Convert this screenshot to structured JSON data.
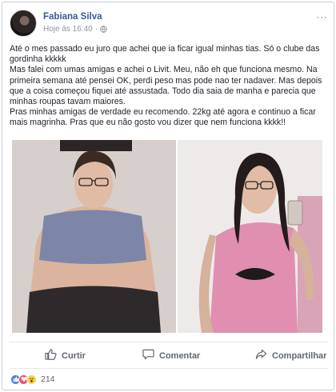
{
  "post": {
    "author": "Fabiana Silva",
    "timestamp": "Hoje às 16:40",
    "more_glyph": "···",
    "paragraphs": [
      "Até o mes passado eu juro que achei que ia ficar igual minhas tias. Só o clube das gordinha kkkkk",
      "Mas falei com umas amigas e achei o Livit. Meu, não eh que funciona mesmo. Na primeira semana até pensei OK, perdi peso mas pode nao ter nadaver. Mas depois que a coisa começou fiquei até assustada. Todo dia saia de manha e parecia que minhas roupas tavam maiores.",
      "Pras minhas amigas de verdade eu recomendo. 22kg até agora e continuo a ficar mais magrinha. Pras que eu não gosto vou dizer que nem funciona kkkk!!"
    ]
  },
  "actions": {
    "like": "Curtir",
    "comment": "Comentar",
    "share": "Compartilhar"
  },
  "reactions": {
    "count": "214",
    "types": [
      "like-icon",
      "love-icon",
      "wow-icon"
    ],
    "colors": {
      "like": "#4f7fe0",
      "love": "#f0506e",
      "wow": "#f7d24c"
    }
  },
  "colors": {
    "author": "#365899",
    "meta": "#90949c",
    "action": "#606770"
  }
}
